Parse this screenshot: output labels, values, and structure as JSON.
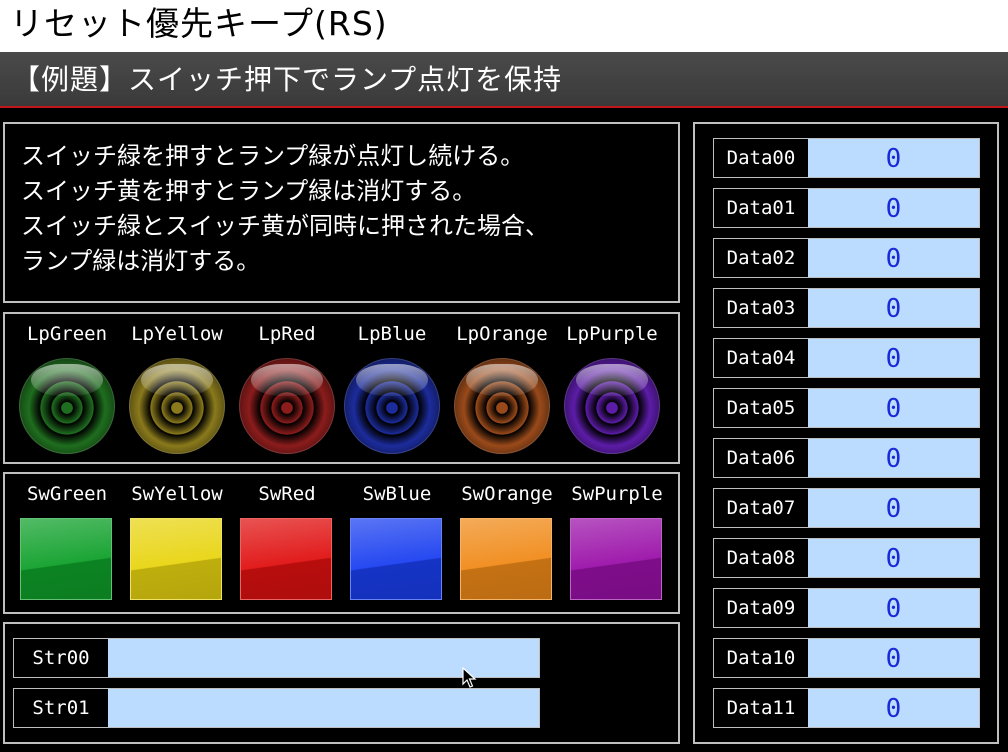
{
  "header": {
    "title": "リセット優先キープ(RS)",
    "subtitle": "【例題】スイッチ押下でランプ点灯を保持"
  },
  "description": {
    "lines": [
      "スイッチ緑を押すとランプ緑が点灯し続ける。",
      "スイッチ黄を押すとランプ緑は消灯する。",
      "スイッチ緑とスイッチ黄が同時に押された場合、",
      "ランプ緑は消灯する。"
    ]
  },
  "lamps": [
    {
      "label": "LpGreen",
      "color": "#1f6e1f",
      "state": "off"
    },
    {
      "label": "LpYellow",
      "color": "#8a7a1c",
      "state": "off"
    },
    {
      "label": "LpRed",
      "color": "#8c1c1c",
      "state": "off"
    },
    {
      "label": "LpBlue",
      "color": "#1c2c9c",
      "state": "off"
    },
    {
      "label": "LpOrange",
      "color": "#9a4a1a",
      "state": "off"
    },
    {
      "label": "LpPurple",
      "color": "#5c1ca8",
      "state": "off"
    }
  ],
  "switches": [
    {
      "label": "SwGreen",
      "color": "#0fa02a"
    },
    {
      "label": "SwYellow",
      "color": "#e8d410"
    },
    {
      "label": "SwRed",
      "color": "#e01010"
    },
    {
      "label": "SwBlue",
      "color": "#1a3ff0"
    },
    {
      "label": "SwOrange",
      "color": "#f08a18"
    },
    {
      "label": "SwPurple",
      "color": "#9a10a8"
    }
  ],
  "strings": [
    {
      "label": "Str00",
      "value": ""
    },
    {
      "label": "Str01",
      "value": ""
    }
  ],
  "data": [
    {
      "label": "Data00",
      "value": "0"
    },
    {
      "label": "Data01",
      "value": "0"
    },
    {
      "label": "Data02",
      "value": "0"
    },
    {
      "label": "Data03",
      "value": "0"
    },
    {
      "label": "Data04",
      "value": "0"
    },
    {
      "label": "Data05",
      "value": "0"
    },
    {
      "label": "Data06",
      "value": "0"
    },
    {
      "label": "Data07",
      "value": "0"
    },
    {
      "label": "Data08",
      "value": "0"
    },
    {
      "label": "Data09",
      "value": "0"
    },
    {
      "label": "Data10",
      "value": "0"
    },
    {
      "label": "Data11",
      "value": "0"
    }
  ],
  "colors": {
    "field_bg": "#bcdcff",
    "value_text": "#1a2ad8",
    "accent_line": "#c01818"
  }
}
